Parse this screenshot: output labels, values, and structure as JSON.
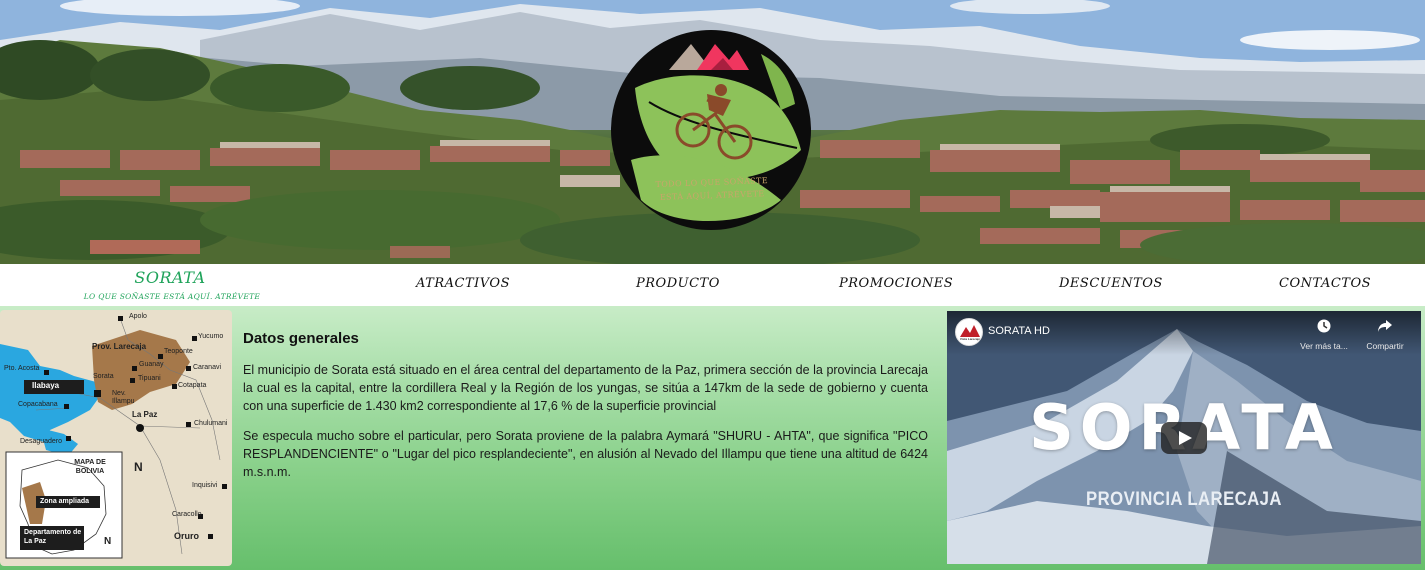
{
  "hero": {
    "logo_caption": "TODO LO QUE SOÑASTE ESTÁ AQUÍ, ATRÉVETE"
  },
  "nav": {
    "brand_title": "SORATA",
    "brand_subtitle": "LO QUE SOÑASTE ESTÁ AQUÍ. ATRÉVETE",
    "links": [
      "ATRACTIVOS",
      "PRODUCTO",
      "PROMOCIONES",
      "DESCUENTOS",
      "CONTACTOS"
    ]
  },
  "map": {
    "labels": {
      "apolo": "Apolo",
      "yucumo": "Yucumo",
      "prov_larecaja": "Prov. Larecaja",
      "teoponte": "Teoponte",
      "pto_acosta": "Pto. Acosta",
      "guanay": "Guanay",
      "caranavi": "Caranavi",
      "ilabaya": "Ilabaya",
      "sorata": "Sorata",
      "tipuani": "Tipuani",
      "cotapata": "Cotapata",
      "copacabana": "Copacabana",
      "nev_illampu": "Nev. Illampu",
      "la_paz": "La Paz",
      "chulumani": "Chulumani",
      "desaguadero": "Desaguadero",
      "mapa_de_bolivia": "MAPA DE BOLIVIA",
      "zona_ampliada": "Zona ampliada",
      "departamento": "Departamento de La Paz",
      "inquisivi": "Inquisivi",
      "caracollo": "Caracollo",
      "oruro": "Oruro",
      "north": "N"
    }
  },
  "article": {
    "heading": "Datos generales",
    "paragraph1": "El municipio de Sorata está situado en el área central del departamento de la Paz, primera sección de la provincia Larecaja la cual es la capital, entre la cordillera Real y la Región de los yungas, se sitúa a 147km de la sede de gobierno y cuenta con una superficie de 1.430 km2 correspondiente al 17,6 % de la superficie provincial",
    "paragraph2": "Se especula mucho sobre el particular, pero Sorata proviene de la palabra Aymará \"SHURU - AHTA\", que significa \"PICO RESPLANDENCIENTE\" o \"Lugar del pico resplandeciente\", en alusión al Nevado del Illampu que tiene una altitud de 6424 m.s.n.m."
  },
  "video": {
    "title": "SORATA HD",
    "watch_later_label": "Ver más ta...",
    "share_label": "Compartir",
    "overlay_title": "SORATA",
    "overlay_subtitle": "PROVINCIA LARECAJA",
    "avatar_text": "Vista Larecaja"
  },
  "colors": {
    "brand_green": "#1fa35a",
    "main_bg_top": "#c8ecc7",
    "main_bg_bottom": "#66bf6c"
  }
}
